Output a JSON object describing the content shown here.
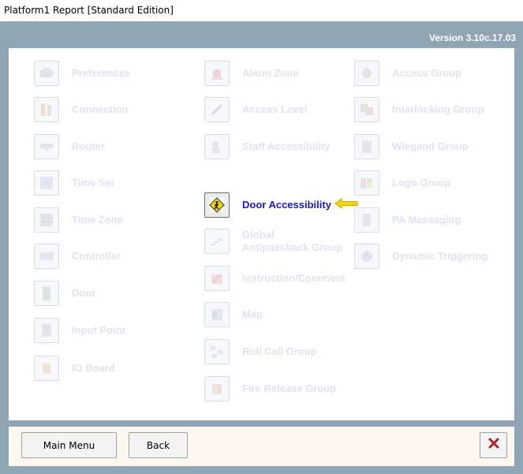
{
  "window": {
    "title": "Platform1 Report [Standard Edition]"
  },
  "header": {
    "version": "Version 3.10c.17.03"
  },
  "colors": {
    "frame": "#8fa5b3",
    "active_label": "#1a1ad0",
    "disabled_label": "#dfe3f2",
    "arrow": "#f5d400",
    "close_x": "#b0202a"
  },
  "menu": {
    "col1": [
      {
        "label": "Preferences",
        "icon": "preferences-icon"
      },
      {
        "label": "Connection",
        "icon": "connection-icon"
      },
      {
        "label": "Router",
        "icon": "router-icon"
      },
      {
        "label": "Time Set",
        "icon": "time-set-icon"
      },
      {
        "label": "Time Zone",
        "icon": "time-zone-icon"
      },
      {
        "label": "Controller",
        "icon": "controller-icon"
      },
      {
        "label": "Door",
        "icon": "door-icon"
      },
      {
        "label": "Input Point",
        "icon": "input-point-icon"
      },
      {
        "label": "IO Board",
        "icon": "io-board-icon"
      }
    ],
    "col2": [
      {
        "label": "Alarm Zone",
        "icon": "alarm-zone-icon"
      },
      {
        "label": "Access Level",
        "icon": "access-level-icon"
      },
      {
        "label": "Staff Accessibility",
        "icon": "staff-accessibility-icon"
      },
      {
        "label": "Door Accessibility",
        "icon": "door-accessibility-icon",
        "active": true
      },
      {
        "label_line1": "Global",
        "label_line2": "Antipassback Group",
        "icon": "global-antipassback-icon"
      },
      {
        "label": "Instruction/Comment",
        "icon": "instruction-comment-icon"
      },
      {
        "label": "Map",
        "icon": "map-icon"
      },
      {
        "label": "Roll Call Group",
        "icon": "roll-call-group-icon"
      },
      {
        "label": "Fire Release Group",
        "icon": "fire-release-group-icon"
      }
    ],
    "col3": [
      {
        "label": "Access Group",
        "icon": "access-group-icon"
      },
      {
        "label": "Interlocking Group",
        "icon": "interlocking-group-icon"
      },
      {
        "label": "Wiegand Group",
        "icon": "wiegand-group-icon"
      },
      {
        "label": "Logo Group",
        "icon": "logo-group-icon"
      },
      {
        "label": "PA Messaging",
        "icon": "pa-messaging-icon"
      },
      {
        "label": "Dynamic Triggering",
        "icon": "dynamic-triggering-icon"
      }
    ]
  },
  "footer": {
    "main_menu_label": "Main Menu",
    "back_label": "Back",
    "close_icon": "close-icon"
  }
}
